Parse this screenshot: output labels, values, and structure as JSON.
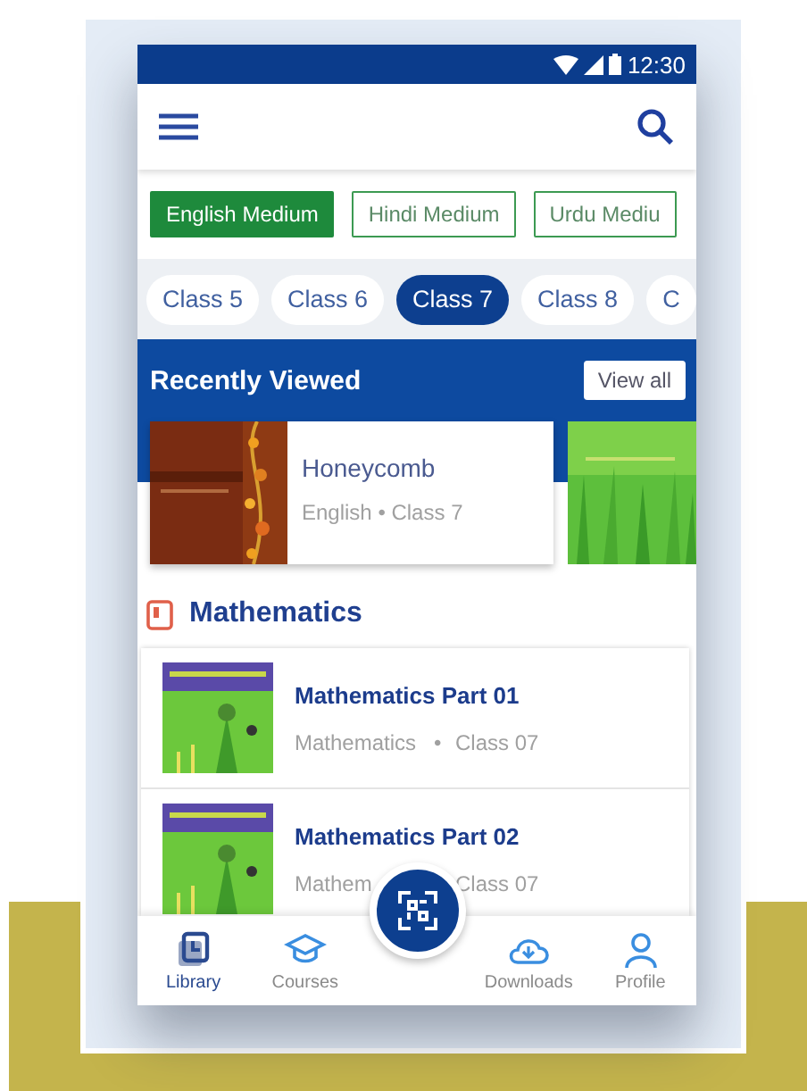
{
  "status_bar": {
    "time": "12:30"
  },
  "mediums": [
    {
      "label": "English Medium",
      "selected": true
    },
    {
      "label": "Hindi Medium",
      "selected": false
    },
    {
      "label": "Urdu Mediu",
      "selected": false
    }
  ],
  "classes": [
    {
      "label": "Class 5",
      "selected": false
    },
    {
      "label": "Class 6",
      "selected": false
    },
    {
      "label": "Class 7",
      "selected": true
    },
    {
      "label": "Class 8",
      "selected": false
    },
    {
      "label": "C",
      "selected": false
    }
  ],
  "recently_viewed": {
    "title": "Recently Viewed",
    "view_all": "View all",
    "items": [
      {
        "kind": "book",
        "title": "Honeycomb",
        "meta": "English • Class 7"
      },
      {
        "kind": "cover_only"
      }
    ]
  },
  "section": {
    "title": "Mathematics",
    "books": [
      {
        "title": "Mathematics Part 01",
        "subject": "Mathematics",
        "separator": "•",
        "class": "Class 07"
      },
      {
        "title": "Mathematics Part 02",
        "subject": "Mathem",
        "class": "Class 07"
      }
    ]
  },
  "bottom_nav": [
    {
      "label": "Library",
      "selected": true
    },
    {
      "label": "Courses",
      "selected": false
    },
    {
      "kind": "scan"
    },
    {
      "label": "Downloads",
      "selected": false
    },
    {
      "label": "Profile",
      "selected": false
    }
  ]
}
